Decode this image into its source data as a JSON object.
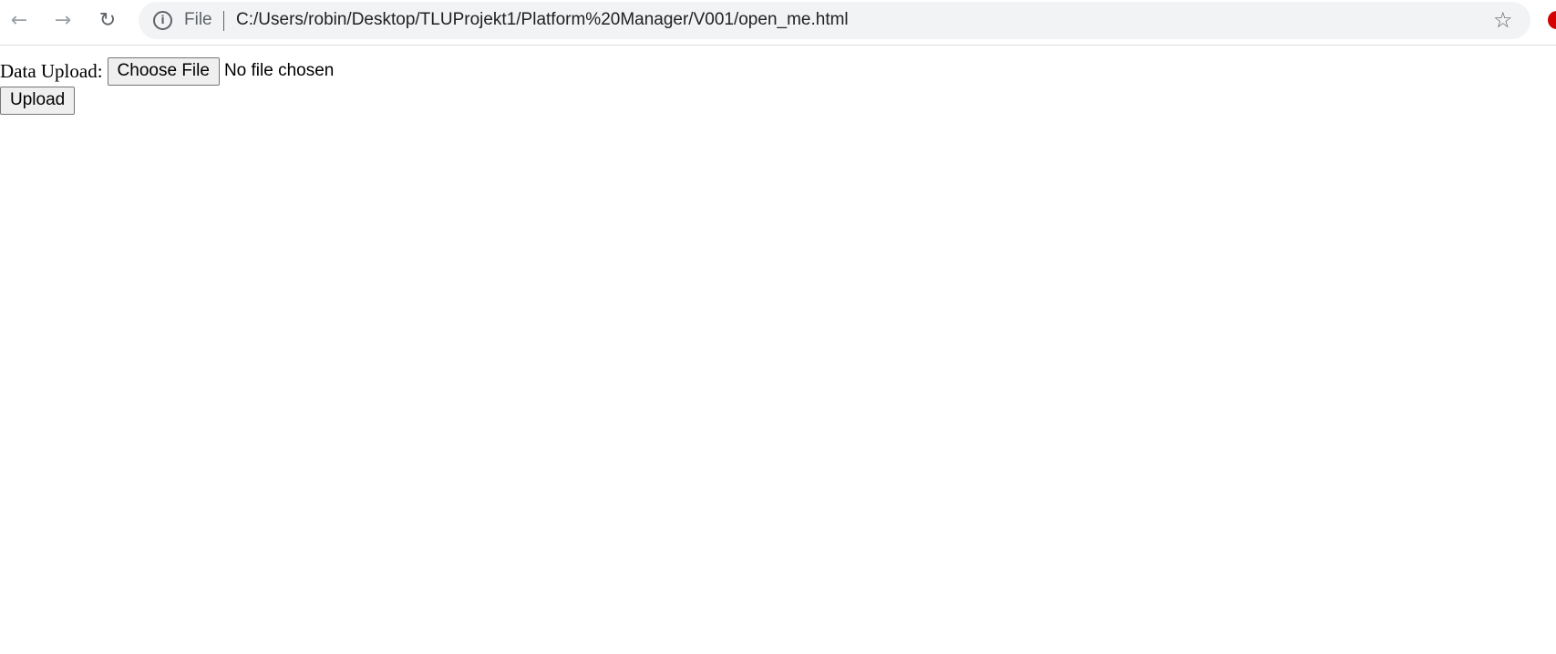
{
  "browser": {
    "back_icon": "arrow-left",
    "forward_icon": "arrow-right",
    "reload_icon": "reload",
    "info_icon": "info-circle",
    "scheme_label": "File",
    "url": "C:/Users/robin/Desktop/TLUProjekt1/Platform%20Manager/V001/open_me.html",
    "bookmark_icon": "star-outline",
    "extension_color": "#d50000"
  },
  "form": {
    "label": "Data Upload:",
    "choose_file_label": "Choose File",
    "file_status": "No file chosen",
    "upload_label": "Upload"
  }
}
